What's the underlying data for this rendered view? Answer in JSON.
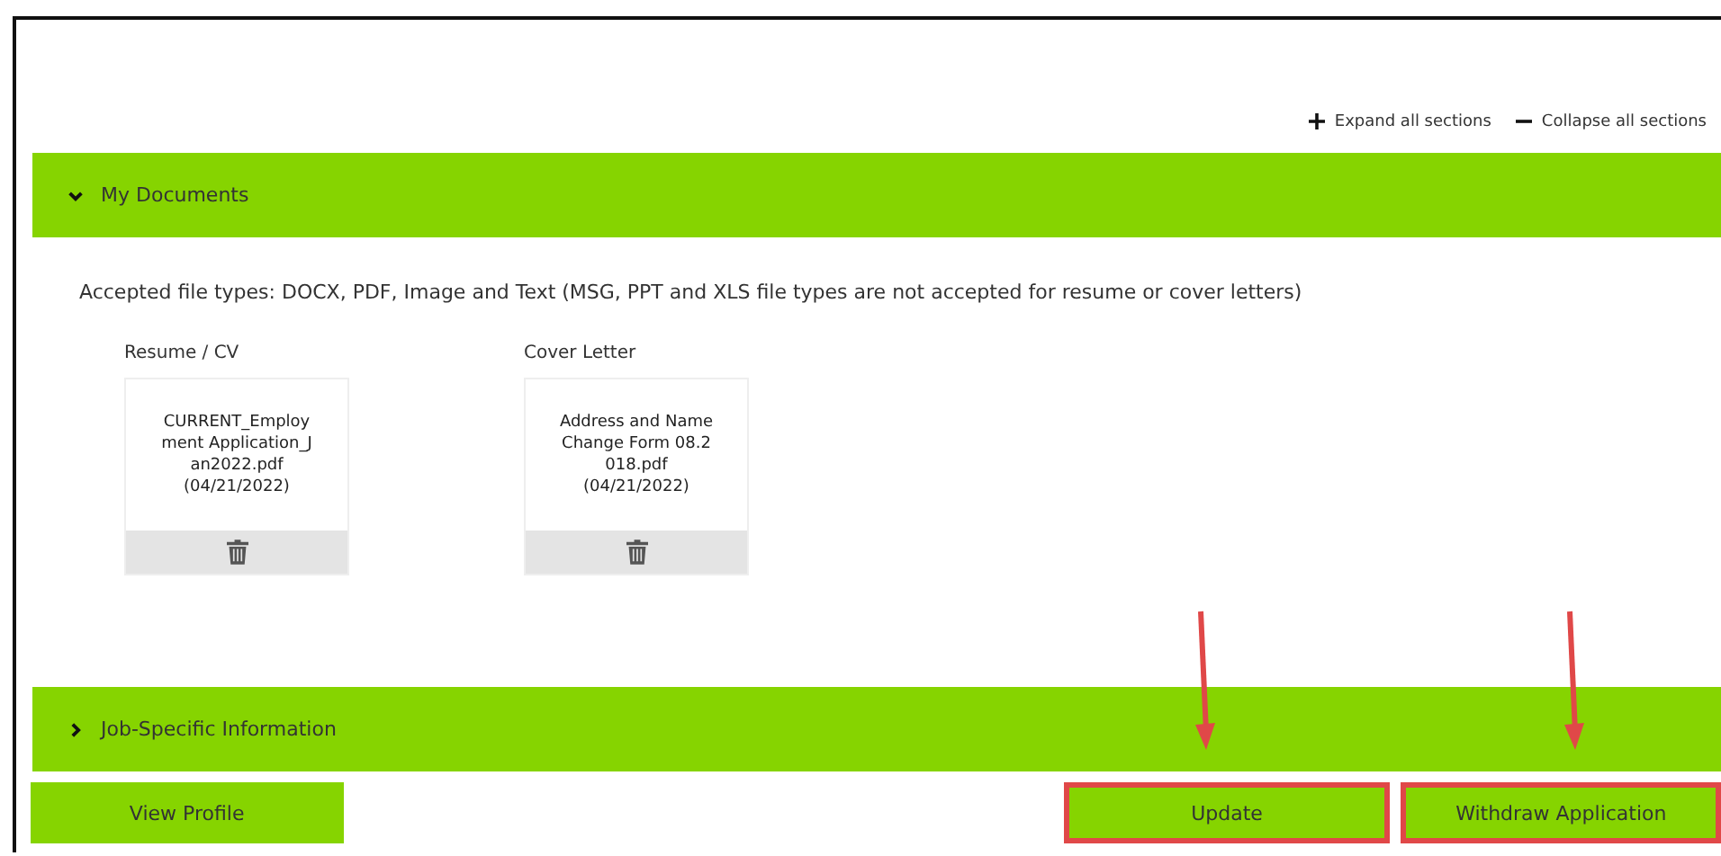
{
  "toolbar": [
    {
      "kind": "expand",
      "label": "Expand all sections"
    },
    {
      "kind": "collapse",
      "label": "Collapse all sections"
    }
  ],
  "sections": [
    {
      "title": "My Documents",
      "expanded": true,
      "note": "Accepted file types: DOCX, PDF, Image and Text (MSG, PPT and XLS file types are not accepted for resume or cover letters)",
      "documents": [
        {
          "label": "Resume / CV",
          "file": "CURRENT_Employment Application_Jan2022.pdf",
          "date": "(04/21/2022)"
        },
        {
          "label": "Cover Letter",
          "file": "Address and Name Change Form 08.2018.pdf",
          "date": "(04/21/2022)"
        }
      ]
    },
    {
      "title": "Job-Specific Information",
      "expanded": false
    }
  ],
  "buttons": [
    {
      "label": "View Profile",
      "highlighted": false
    },
    {
      "label": "Update",
      "highlighted": true
    },
    {
      "label": "Withdraw Application",
      "highlighted": true
    }
  ]
}
